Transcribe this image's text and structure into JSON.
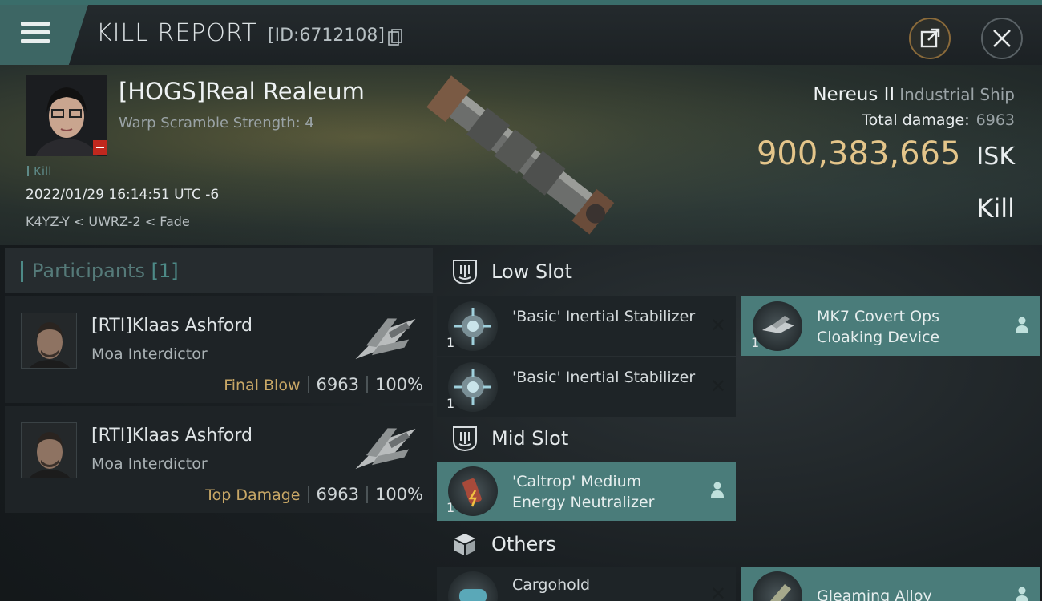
{
  "header": {
    "title": "KILL REPORT",
    "id_text": "[ID:6712108]"
  },
  "victim": {
    "name": "[HOGS]Real Realeum",
    "warp_scramble": "Warp Scramble Strength: 4",
    "kill_tag": "Kill",
    "date": "2022/01/29 16:14:51 UTC -6",
    "location": "K4YZ-Y < UWRZ-2 < Fade",
    "ship_name": "Nereus II",
    "ship_class": "Industrial Ship",
    "damage_label": "Total damage:",
    "damage_value": "6963",
    "isk_value": "900,383,665",
    "isk_unit": "ISK",
    "result": "Kill"
  },
  "participants": {
    "title": "Participants",
    "count": "[1]",
    "items": [
      {
        "name": "[RTI]Klaas Ashford",
        "ship": "Moa Interdictor",
        "label": "Final Blow",
        "damage": "6963",
        "percent": "100%"
      },
      {
        "name": "[RTI]Klaas Ashford",
        "ship": "Moa Interdictor",
        "label": "Top Damage",
        "damage": "6963",
        "percent": "100%"
      }
    ]
  },
  "fitting": {
    "low_slot": {
      "title": "Low Slot",
      "modules": [
        {
          "name": "'Basic' Inertial Stabilizer",
          "qty": "1",
          "status": "destroyed"
        },
        {
          "name": "'Basic' Inertial Stabilizer",
          "qty": "1",
          "status": "destroyed"
        },
        {
          "name": "MK7 Covert Ops Cloaking Device",
          "qty": "1",
          "status": "dropped"
        }
      ]
    },
    "mid_slot": {
      "title": "Mid Slot",
      "modules": [
        {
          "name": "'Caltrop' Medium Energy Neutralizer",
          "qty": "1",
          "status": "dropped"
        }
      ]
    },
    "others": {
      "title": "Others",
      "modules": [
        {
          "name": "Cargohold",
          "qty": "",
          "status": "destroyed"
        },
        {
          "name": "Gleaming Alloy",
          "qty": "",
          "status": "dropped"
        }
      ]
    }
  },
  "colors": {
    "accent_teal": "#4a7c7a",
    "isk_gold": "#e4c58a",
    "label_gold": "#c8a766",
    "kill_red": "#c0281e"
  }
}
